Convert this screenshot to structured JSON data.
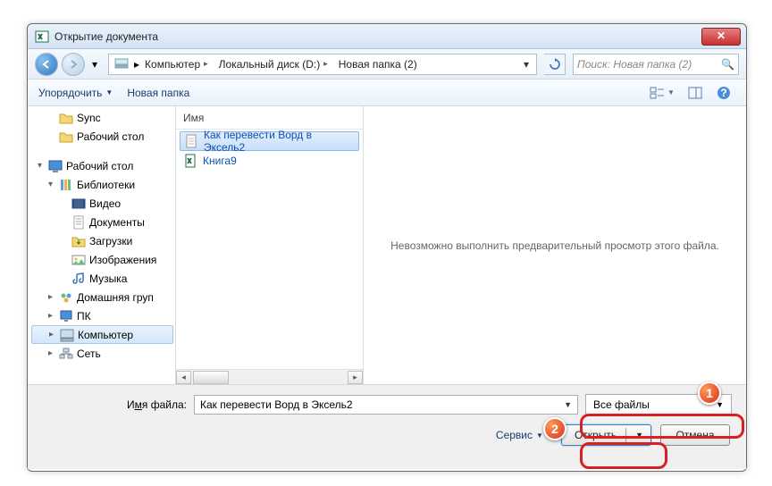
{
  "window": {
    "title": "Открытие документа"
  },
  "nav": {
    "segments": [
      "Компьютер",
      "Локальный диск (D:)",
      "Новая папка (2)"
    ],
    "search_placeholder": "Поиск: Новая папка (2)"
  },
  "toolbar": {
    "organize": "Упорядочить",
    "new_folder": "Новая папка"
  },
  "tree": {
    "items": [
      {
        "label": "Sync",
        "icon": "folder",
        "lvl": 1
      },
      {
        "label": "Рабочий стол",
        "icon": "folder",
        "lvl": 1
      },
      {
        "label": "",
        "spacer": true
      },
      {
        "label": "Рабочий стол",
        "icon": "desktop",
        "lvl": 0,
        "exp": "▾"
      },
      {
        "label": "Библиотеки",
        "icon": "libraries",
        "lvl": 1,
        "exp": "▾"
      },
      {
        "label": "Видео",
        "icon": "video",
        "lvl": 2
      },
      {
        "label": "Документы",
        "icon": "doc",
        "lvl": 2
      },
      {
        "label": "Загрузки",
        "icon": "download",
        "lvl": 2
      },
      {
        "label": "Изображения",
        "icon": "image",
        "lvl": 2
      },
      {
        "label": "Музыка",
        "icon": "music",
        "lvl": 2
      },
      {
        "label": "Домашняя груп",
        "icon": "homegroup",
        "lvl": 1,
        "exp": "▸"
      },
      {
        "label": "ПК",
        "icon": "pc",
        "lvl": 1,
        "exp": "▸"
      },
      {
        "label": "Компьютер",
        "icon": "computer",
        "lvl": 1,
        "exp": "▸",
        "sel": true
      },
      {
        "label": "Сеть",
        "icon": "network",
        "lvl": 1,
        "exp": "▸"
      }
    ]
  },
  "files": {
    "header": "Имя",
    "items": [
      {
        "label": "Как перевести Ворд в Эксель2",
        "icon": "txt",
        "sel": true
      },
      {
        "label": "Книга9",
        "icon": "xls"
      }
    ]
  },
  "preview": {
    "message": "Невозможно выполнить предварительный просмотр этого файла."
  },
  "bottom": {
    "filename_label_pre": "И",
    "filename_label_u": "м",
    "filename_label_post": "я файла:",
    "filename_value": "Как перевести Ворд в Эксель2",
    "filetype_value": "Все файлы",
    "service": "Сервис",
    "open": "Открыть",
    "cancel": "Отмена"
  },
  "badges": {
    "one": "1",
    "two": "2"
  }
}
